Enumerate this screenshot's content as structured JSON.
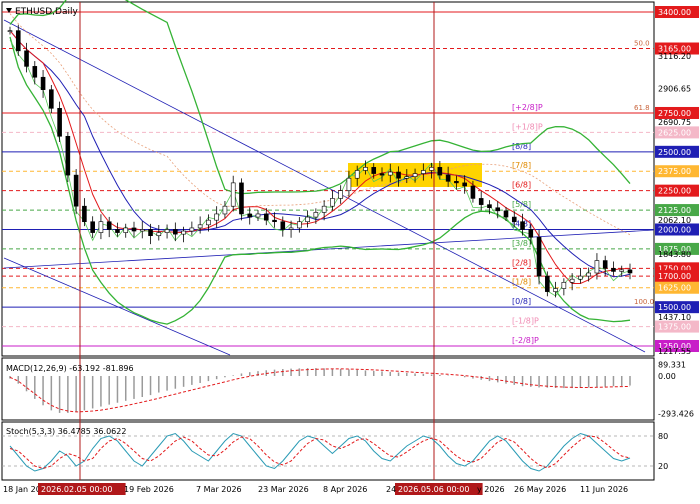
{
  "chart_data": {
    "type": "line",
    "title": "ETHUSD,Daily",
    "symbol": "ETHUSD",
    "timeframe": "Daily",
    "x_labels": [
      "18 Jan 2026",
      "2026.02.05 00:00",
      "19 Feb 2026",
      "7 Mar 2026",
      "23 Mar 2026",
      "8 Apr 2026",
      "2026.05.06 00:00",
      "26 May 2026",
      "11 Jun 2026"
    ],
    "x_labels_clipped": [
      "24",
      "y 2026"
    ],
    "price_axis": {
      "ylim": [
        1200,
        3420
      ],
      "ticks": [
        {
          "label": "3400.00",
          "value": 3400,
          "boxed": true,
          "color": "#e31a1c"
        },
        {
          "label": "3165.00",
          "value": 3165,
          "boxed": true,
          "color": "#e31a1c"
        },
        {
          "label": "3116.20",
          "value": 3116.2,
          "boxed": false
        },
        {
          "label": "2906.65",
          "value": 2906.65,
          "boxed": false
        },
        {
          "label": "2750.00",
          "value": 2750,
          "boxed": true,
          "color": "#e31a1c"
        },
        {
          "label": "2690.75",
          "value": 2690.75,
          "boxed": false
        },
        {
          "label": "2625.00",
          "value": 2625,
          "boxed": true,
          "color": "#f4b8c8"
        },
        {
          "label": "2500.00",
          "value": 2500,
          "boxed": true,
          "color": "#1f1fb4"
        },
        {
          "label": "2375.00",
          "value": 2375,
          "boxed": true,
          "color": "#ffb732"
        },
        {
          "label": "2250.00",
          "value": 2250,
          "boxed": true,
          "color": "#e31a1c"
        },
        {
          "label": "2125.00",
          "value": 2125,
          "boxed": true,
          "color": "#48a848"
        },
        {
          "label": "2062.10",
          "value": 2062.1,
          "boxed": false
        },
        {
          "label": "2000.00",
          "value": 2000,
          "boxed": true,
          "color": "#1f1fb4"
        },
        {
          "label": "1875.00",
          "value": 1875,
          "boxed": true,
          "color": "#48a848"
        },
        {
          "label": "1843.80",
          "value": 1843.8,
          "boxed": false
        },
        {
          "label": "1750.00",
          "value": 1750,
          "boxed": true,
          "color": "#e31a1c"
        },
        {
          "label": "1700.00",
          "value": 1700,
          "boxed": true,
          "color": "#e31a1c"
        },
        {
          "label": "1625.00",
          "value": 1625,
          "boxed": true,
          "color": "#ffb732"
        },
        {
          "label": "1500.00",
          "value": 1500,
          "boxed": true,
          "color": "#1f1fb4"
        },
        {
          "label": "1437.10",
          "value": 1437.1,
          "boxed": false
        },
        {
          "label": "1375.00",
          "value": 1375,
          "boxed": true,
          "color": "#f4b8c8"
        },
        {
          "label": "1250.00",
          "value": 1250,
          "boxed": true,
          "color": "#c81ec8"
        },
        {
          "label": "1217.55",
          "value": 1217.55,
          "boxed": false
        }
      ]
    },
    "murrey_labels": [
      {
        "label": "[8/8]",
        "value": 2500,
        "color": "#1f1fb4"
      },
      {
        "label": "[7/8]",
        "value": 2375,
        "color": "#e08a00"
      },
      {
        "label": "[6/8]",
        "value": 2250,
        "color": "#e31a1c"
      },
      {
        "label": "[5/8]",
        "value": 2125,
        "color": "#48a848"
      },
      {
        "label": "[4/8]",
        "value": 2000,
        "color": "#1f1fb4"
      },
      {
        "label": "[3/8]",
        "value": 1875,
        "color": "#48a848"
      },
      {
        "label": "[2/8]",
        "value": 1750,
        "color": "#e31a1c"
      },
      {
        "label": "[1/8]",
        "value": 1625,
        "color": "#e08a00"
      },
      {
        "label": "[0/8]",
        "value": 1500,
        "color": "#1f1fb4"
      },
      {
        "label": "[-1/8]P",
        "value": 1375,
        "color": "#f08cb4"
      },
      {
        "label": "[-2/8]P",
        "value": 1250,
        "color": "#c81ec8"
      },
      {
        "label": "[+1/8]P",
        "value": 2625,
        "color": "#f08cb4"
      },
      {
        "label": "[+2/8]P",
        "value": 2750,
        "color": "#c81ec8"
      }
    ],
    "fib_labels": [
      {
        "label": "50.0",
        "value": 3165
      },
      {
        "label": "61.8",
        "value": 2750
      },
      {
        "label": "100.0",
        "value": 1500
      }
    ],
    "close_series": [
      3280,
      3150,
      3050,
      2980,
      2900,
      2780,
      2600,
      2350,
      2150,
      2050,
      1980,
      2050,
      2000,
      1980,
      2010,
      1990,
      2000,
      1960,
      1980,
      2000,
      1970,
      1990,
      2010,
      2030,
      2060,
      2100,
      2150,
      2300,
      2100,
      2080,
      2100,
      2060,
      2050,
      2000,
      2010,
      2050,
      2080,
      2110,
      2150,
      2200,
      2250,
      2330,
      2380,
      2400,
      2360,
      2350,
      2370,
      2330,
      2340,
      2360,
      2380,
      2400,
      2350,
      2310,
      2300,
      2280,
      2200,
      2160,
      2140,
      2120,
      2080,
      2050,
      2000,
      1950,
      1700,
      1600,
      1620,
      1660,
      1680,
      1700,
      1720,
      1800,
      1750,
      1730,
      1740,
      1720
    ],
    "macd": {
      "label": "MACD(12,26,9) -63.192 -81.896",
      "axis_ticks": [
        {
          "label": "89.331",
          "value": 89.331
        },
        {
          "label": "0.00",
          "value": 0
        },
        {
          "label": "-293.426",
          "value": -293.426
        }
      ],
      "ylim": [
        -330,
        110
      ],
      "histogram": [
        -20,
        -60,
        -120,
        -180,
        -230,
        -270,
        -290,
        -290,
        -280,
        -270,
        -255,
        -240,
        -225,
        -210,
        -195,
        -180,
        -165,
        -150,
        -130,
        -115,
        -100,
        -85,
        -70,
        -55,
        -40,
        -25,
        -10,
        5,
        20,
        30,
        38,
        45,
        50,
        55,
        58,
        60,
        62,
        62,
        60,
        58,
        55,
        52,
        48,
        44,
        40,
        36,
        32,
        28,
        24,
        20,
        16,
        12,
        8,
        4,
        0,
        -10,
        -20,
        -30,
        -40,
        -50,
        -60,
        -70,
        -80,
        -85,
        -90,
        -92,
        -94,
        -95,
        -95,
        -93,
        -90,
        -87,
        -84,
        -80,
        -78,
        -75
      ],
      "signal": [
        -10,
        -40,
        -90,
        -140,
        -190,
        -230,
        -260,
        -275,
        -282,
        -280,
        -275,
        -268,
        -258,
        -246,
        -233,
        -219,
        -205,
        -190,
        -175,
        -158,
        -142,
        -126,
        -110,
        -94,
        -78,
        -62,
        -46,
        -30,
        -15,
        -2,
        10,
        20,
        28,
        35,
        41,
        46,
        50,
        53,
        55,
        56,
        56,
        55,
        53,
        51,
        48,
        45,
        41,
        37,
        33,
        29,
        25,
        21,
        17,
        13,
        9,
        3,
        -4,
        -12,
        -21,
        -30,
        -40,
        -50,
        -60,
        -68,
        -75,
        -80,
        -84,
        -87,
        -89,
        -90,
        -90,
        -89,
        -87,
        -85,
        -83,
        -82
      ]
    },
    "stoch": {
      "label": "Stoch(5,3,3) 36.4785 36.0622",
      "axis_ticks": [
        {
          "label": "80",
          "value": 80
        },
        {
          "label": "20",
          "value": 20
        }
      ],
      "ylim": [
        0,
        100
      ],
      "k": [
        60,
        40,
        20,
        10,
        15,
        30,
        50,
        40,
        20,
        30,
        55,
        75,
        80,
        70,
        50,
        30,
        20,
        40,
        60,
        80,
        85,
        70,
        50,
        40,
        30,
        50,
        70,
        85,
        80,
        60,
        40,
        20,
        15,
        30,
        50,
        70,
        80,
        75,
        60,
        45,
        60,
        75,
        80,
        70,
        50,
        35,
        30,
        45,
        60,
        70,
        80,
        75,
        60,
        40,
        25,
        20,
        30,
        50,
        70,
        80,
        70,
        50,
        30,
        15,
        10,
        20,
        40,
        60,
        75,
        85,
        80,
        65,
        50,
        35,
        30,
        36
      ],
      "d": [
        55,
        50,
        35,
        20,
        15,
        20,
        35,
        45,
        40,
        30,
        35,
        55,
        70,
        75,
        65,
        50,
        35,
        30,
        40,
        55,
        70,
        78,
        70,
        55,
        42,
        40,
        52,
        68,
        78,
        75,
        60,
        42,
        28,
        22,
        30,
        48,
        65,
        75,
        72,
        60,
        55,
        62,
        72,
        75,
        65,
        52,
        40,
        38,
        48,
        60,
        70,
        76,
        70,
        55,
        40,
        30,
        28,
        35,
        52,
        68,
        75,
        68,
        52,
        35,
        22,
        16,
        25,
        42,
        58,
        72,
        80,
        78,
        66,
        52,
        40,
        36
      ]
    },
    "vertical_markers": [
      "2026.02.05 00:00",
      "2026.05.06 00:00"
    ]
  },
  "colors": {
    "price_candle": "#000000",
    "bollinger": "#35b335",
    "ma_blue": "#1f1fb4",
    "ma_red": "#e31a1c",
    "ma_salmon": "#e8a07a",
    "marker_line": "#b0181a",
    "yellow_box": "#ffd400"
  }
}
